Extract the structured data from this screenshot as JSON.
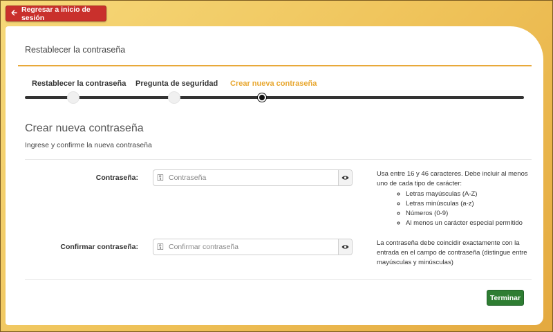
{
  "header": {
    "back_button": {
      "icon": "arrow-left-icon",
      "label": "Regresar a inicio de sesión",
      "color": "#c9302c"
    }
  },
  "panel": {
    "title": "Restablecer la contraseña"
  },
  "steps": [
    {
      "label": "Restablecer la contraseña",
      "active": false
    },
    {
      "label": "Pregunta de seguridad",
      "active": false
    },
    {
      "label": "Crear nueva contraseña",
      "active": true
    }
  ],
  "section": {
    "title": "Crear nueva contraseña",
    "subtitle": "Ingrese y confirme la nueva contraseña"
  },
  "password": {
    "label": "Contraseña:",
    "placeholder": "Contraseña",
    "value": "",
    "help_intro": "Usa entre 16 y 46 caracteres. Debe incluir al menos uno de cada tipo de carácter:",
    "help_items": [
      "Letras mayúsculas (A-Z)",
      "Letras minúsculas (a-z)",
      "Números (0-9)",
      "Al menos un carácter especial permitido"
    ]
  },
  "confirm": {
    "label": "Confirmar contraseña:",
    "placeholder": "Confirmar contraseña",
    "value": "",
    "help": "La contraseña debe coincidir exactamente con la entrada en el campo de contraseña (distingue entre mayúsculas y minúsculas)"
  },
  "footer": {
    "finish_label": "Terminar",
    "finish_color": "#2e7d32"
  },
  "colors": {
    "accent": "#e8a72f",
    "background": "#efc35a"
  }
}
